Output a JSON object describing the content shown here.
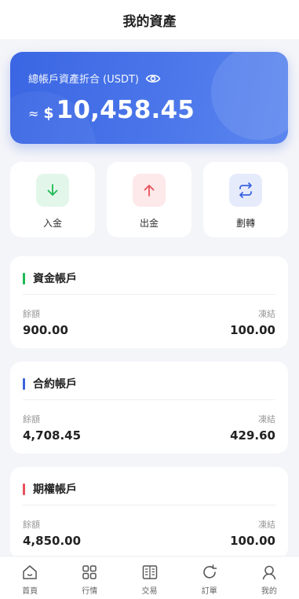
{
  "header": {
    "title": "我的資產"
  },
  "hero": {
    "label": "總帳戶資產折合 (USDT)",
    "approx": "≈",
    "currency": "$",
    "amount": "10,458.45"
  },
  "actions": [
    {
      "label": "入金",
      "icon": "arrow-down-icon",
      "bg": "#e3f6ea",
      "color": "#1db954"
    },
    {
      "label": "出金",
      "icon": "arrow-up-icon",
      "bg": "#fde8ea",
      "color": "#e8505b"
    },
    {
      "label": "劃轉",
      "icon": "swap-icon",
      "bg": "#e6ebfb",
      "color": "#3b63de"
    }
  ],
  "accounts": [
    {
      "title": "資金帳戶",
      "color": "#1db954",
      "balance_label": "餘額",
      "balance": "900.00",
      "frozen_label": "凍結",
      "frozen": "100.00"
    },
    {
      "title": "合約帳戶",
      "color": "#3b63de",
      "balance_label": "餘額",
      "balance": "4,708.45",
      "frozen_label": "凍結",
      "frozen": "429.60"
    },
    {
      "title": "期權帳戶",
      "color": "#e8505b",
      "balance_label": "餘額",
      "balance": "4,850.00",
      "frozen_label": "凍結",
      "frozen": "100.00"
    }
  ],
  "tabs": [
    {
      "label": "首頁",
      "icon": "home-icon"
    },
    {
      "label": "行情",
      "icon": "market-icon"
    },
    {
      "label": "交易",
      "icon": "trade-icon"
    },
    {
      "label": "訂單",
      "icon": "orders-icon"
    },
    {
      "label": "我的",
      "icon": "profile-icon"
    }
  ]
}
